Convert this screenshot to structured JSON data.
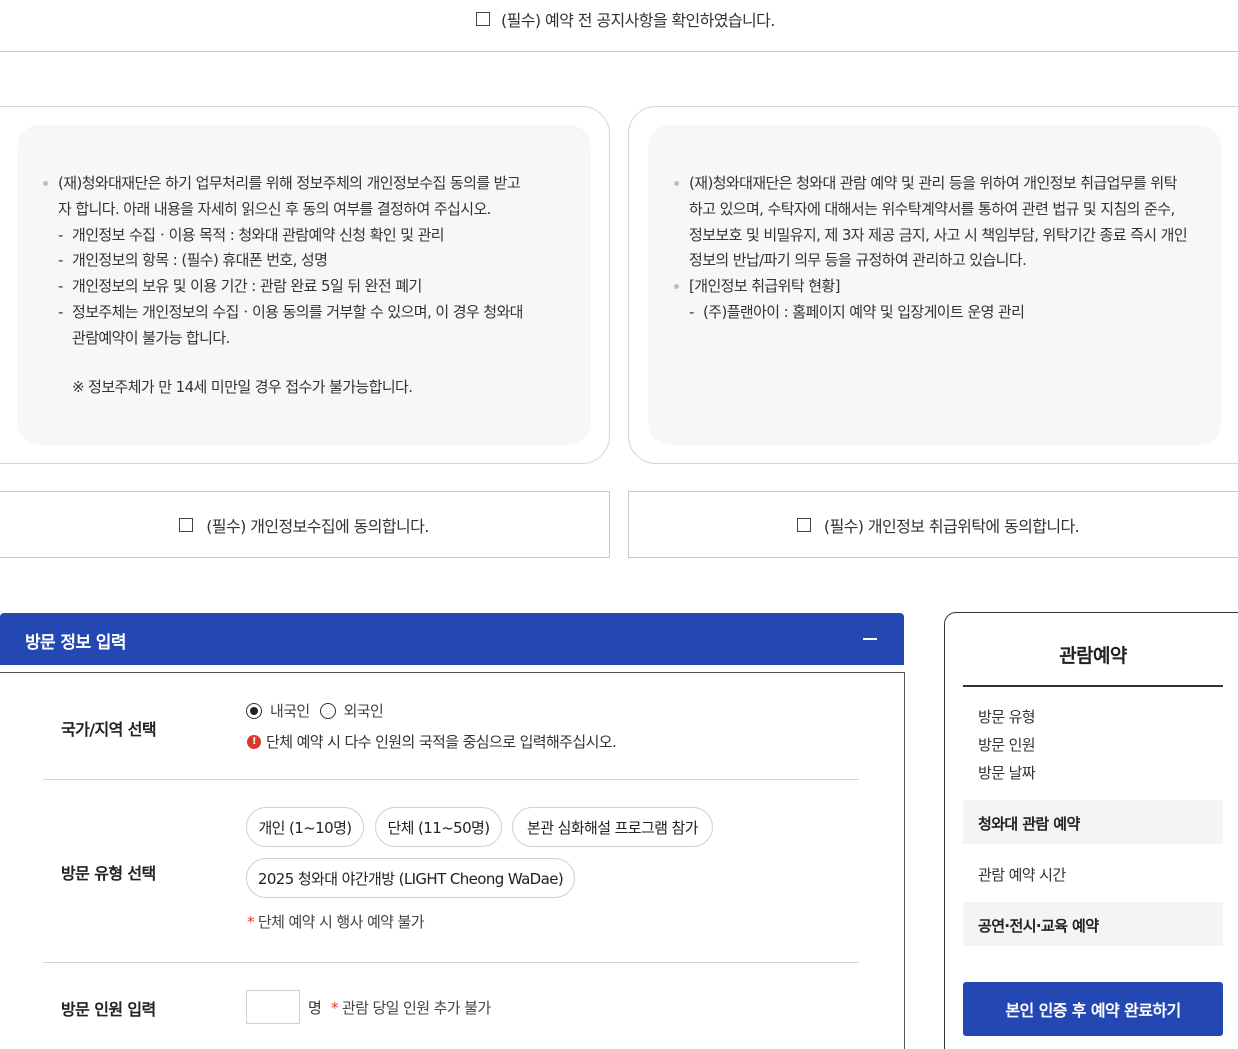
{
  "notice": {
    "label": "(필수) 예약 전 공지사항을 확인하였습니다."
  },
  "terms_left": {
    "intro": "(재)청와대재단은 하기 업무처리를 위해 정보주체의 개인정보수집 동의를 받고자 합니다. 아래 내용을 자세히 읽으신 후 동의 여부를 결정하여 주십시오.",
    "items": [
      "개인정보 수집ㆍ이용 목적 : 청와대 관람예약 신청 확인 및 관리",
      "개인정보의 항목 : (필수) 휴대폰 번호, 성명",
      "개인정보의 보유 및 이용 기간 : 관람 완료 5일 뒤 완전 폐기",
      "정보주체는 개인정보의 수집ㆍ이용 동의를 거부할 수 있으며, 이 경우 청와대 관람예약이 불가능 합니다."
    ],
    "note": "※ 정보주체가 만 14세 미만일 경우 접수가 불가능합니다."
  },
  "terms_right": {
    "intro": "(재)청와대재단은 청와대 관람 예약 및 관리 등을 위하여 개인정보 취급업무를 위탁하고 있으며, 수탁자에 대해서는 위수탁계약서를 통하여 관련 법규 및 지침의 준수, 정보보호 및 비밀유지, 제 3자 제공 금지, 사고 시 책임부담, 위탁기간 종료 즉시 개인정보의 반납/파기 의무 등을 규정하여 관리하고 있습니다.",
    "status_title": "[개인정보 취급위탁 현황]",
    "items": [
      "(주)플랜아이 : 홈페이지 예약 및 입장게이트 운영 관리"
    ]
  },
  "agree": {
    "collect": "(필수) 개인정보수집에 동의합니다.",
    "outsource": "(필수) 개인정보 취급위탁에 동의합니다."
  },
  "visit": {
    "header": "방문 정보 입력",
    "country_label": "국가/지역 선택",
    "radio_domestic": "내국인",
    "radio_foreign": "외국인",
    "country_info": "단체 예약 시 다수 인원의 국적을 중심으로 입력해주십시오.",
    "type_label": "방문 유형 선택",
    "type_options": [
      "개인 (1~10명)",
      "단체 (11~50명)",
      "본관 심화해설 프로그램 참가",
      "2025 청와대 야간개방 (LIGHT Cheong WaDae)"
    ],
    "type_note": "단체 예약 시 행사 예약 불가",
    "count_label": "방문 인원 입력",
    "count_value": "",
    "count_unit": "명",
    "count_note": "관람 당일 인원 추가 불가"
  },
  "summary": {
    "title": "관람예약",
    "items": [
      "방문 유형",
      "방문 인원",
      "방문 날짜"
    ],
    "band1": "청와대 관람 예약",
    "plain": "관람 예약 시간",
    "band2": "공연·전시·교육 예약",
    "button": "본인 인증 후 예약 완료하기"
  },
  "colors": {
    "primary": "#2348b4",
    "required": "#d93a2b"
  }
}
